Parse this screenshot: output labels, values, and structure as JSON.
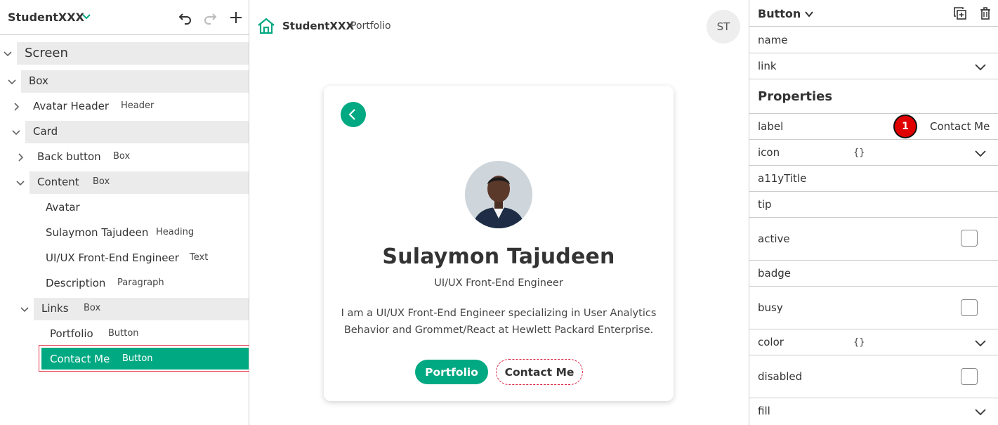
{
  "left_panel": {
    "app_name": "StudentXXX",
    "tree": {
      "screen": "Screen",
      "box": "Box",
      "avatar_header": {
        "label": "Avatar Header",
        "type": "Header"
      },
      "card": "Card",
      "back_button": {
        "label": "Back button",
        "type": "Box"
      },
      "content": {
        "label": "Content",
        "type": "Box"
      },
      "avatar": "Avatar",
      "heading": {
        "label": "Sulaymon Tajudeen",
        "type": "Heading"
      },
      "text": {
        "label": "UI/UX Front-End Engineer",
        "type": "Text"
      },
      "description": {
        "label": "Description",
        "type": "Paragraph"
      },
      "links": {
        "label": "Links",
        "type": "Box"
      },
      "portfolio": {
        "label": "Portfolio",
        "type": "Button"
      },
      "contact": {
        "label": "Contact Me",
        "type": "Button"
      }
    }
  },
  "canvas": {
    "brand": "StudentXXX",
    "brand_sub": "Portfolio",
    "avatar_initials": "ST",
    "card": {
      "name": "Sulaymon Tajudeen",
      "role": "UI/UX Front-End Engineer",
      "description": "I am a UI/UX Front-End Engineer specializing in User Analytics Behavior and Grommet/React at Hewlett Packard Enterprise.",
      "portfolio_button": "Portfolio",
      "contact_button": "Contact Me"
    }
  },
  "right_panel": {
    "title": "Button",
    "name_label": "name",
    "link_label": "link",
    "section": "Properties",
    "label_label": "label",
    "label_value": "Contact Me",
    "badge_number": "1",
    "icon_label": "icon",
    "icon_value": "{}",
    "a11y_label": "a11yTitle",
    "tip_label": "tip",
    "active_label": "active",
    "badge_label": "badge",
    "busy_label": "busy",
    "color_label": "color",
    "color_value": "{}",
    "disabled_label": "disabled",
    "fill_label": "fill"
  },
  "colors": {
    "accent": "#01a982",
    "selection_outline": "#e6354a",
    "dashed_focus": "#d9203e",
    "badge_red": "#e00000"
  }
}
